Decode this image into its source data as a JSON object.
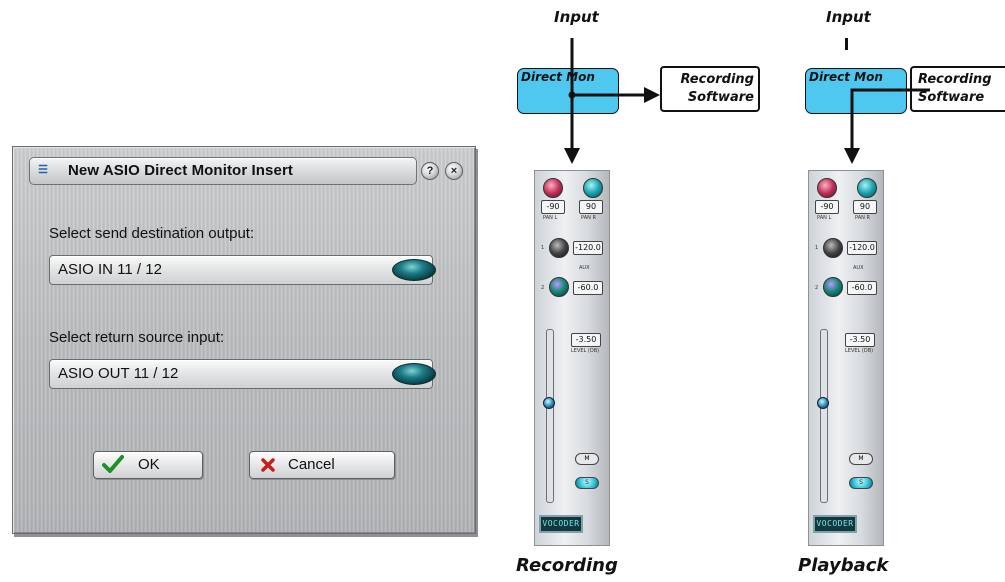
{
  "dialog": {
    "title": "New ASIO Direct Monitor Insert",
    "menu_icon": "menu-icon",
    "help_symbol": "?",
    "close_symbol": "×",
    "send_label": "Select send destination output:",
    "send_value": "ASIO IN 11 / 12",
    "return_label": "Select return source input:",
    "return_value": "ASIO OUT  11 / 12",
    "ok_label": "OK",
    "cancel_label": "Cancel",
    "ok_icon": "checkmark-icon",
    "cancel_icon": "x-icon"
  },
  "diagram_recording": {
    "input_label": "Input",
    "direct_mon_label": "Direct Mon",
    "software_line1": "Recording",
    "software_line2": "Software",
    "caption": "Recording"
  },
  "diagram_playback": {
    "input_label": "Input",
    "direct_mon_label": "Direct Mon",
    "software_line1": "Recording",
    "software_line2": "Software",
    "caption": "Playback"
  },
  "strip": {
    "pan_l_value": "-90",
    "pan_r_value": "90",
    "pan_l_label": "PAN L",
    "pan_r_label": "PAN R",
    "aux1_value": "-120.0",
    "aux2_value": "-60.0",
    "aux_label": "AUX",
    "aux1_index": "1",
    "aux2_index": "2",
    "level_value": "-3.50",
    "level_label": "LEVEL (DB)",
    "mute_label": "M",
    "solo_label": "S",
    "plugin_label": "VOCODER"
  },
  "colors": {
    "direct_mon_fill": "#4fc8f0",
    "knob_accent": "#1d7c86"
  }
}
